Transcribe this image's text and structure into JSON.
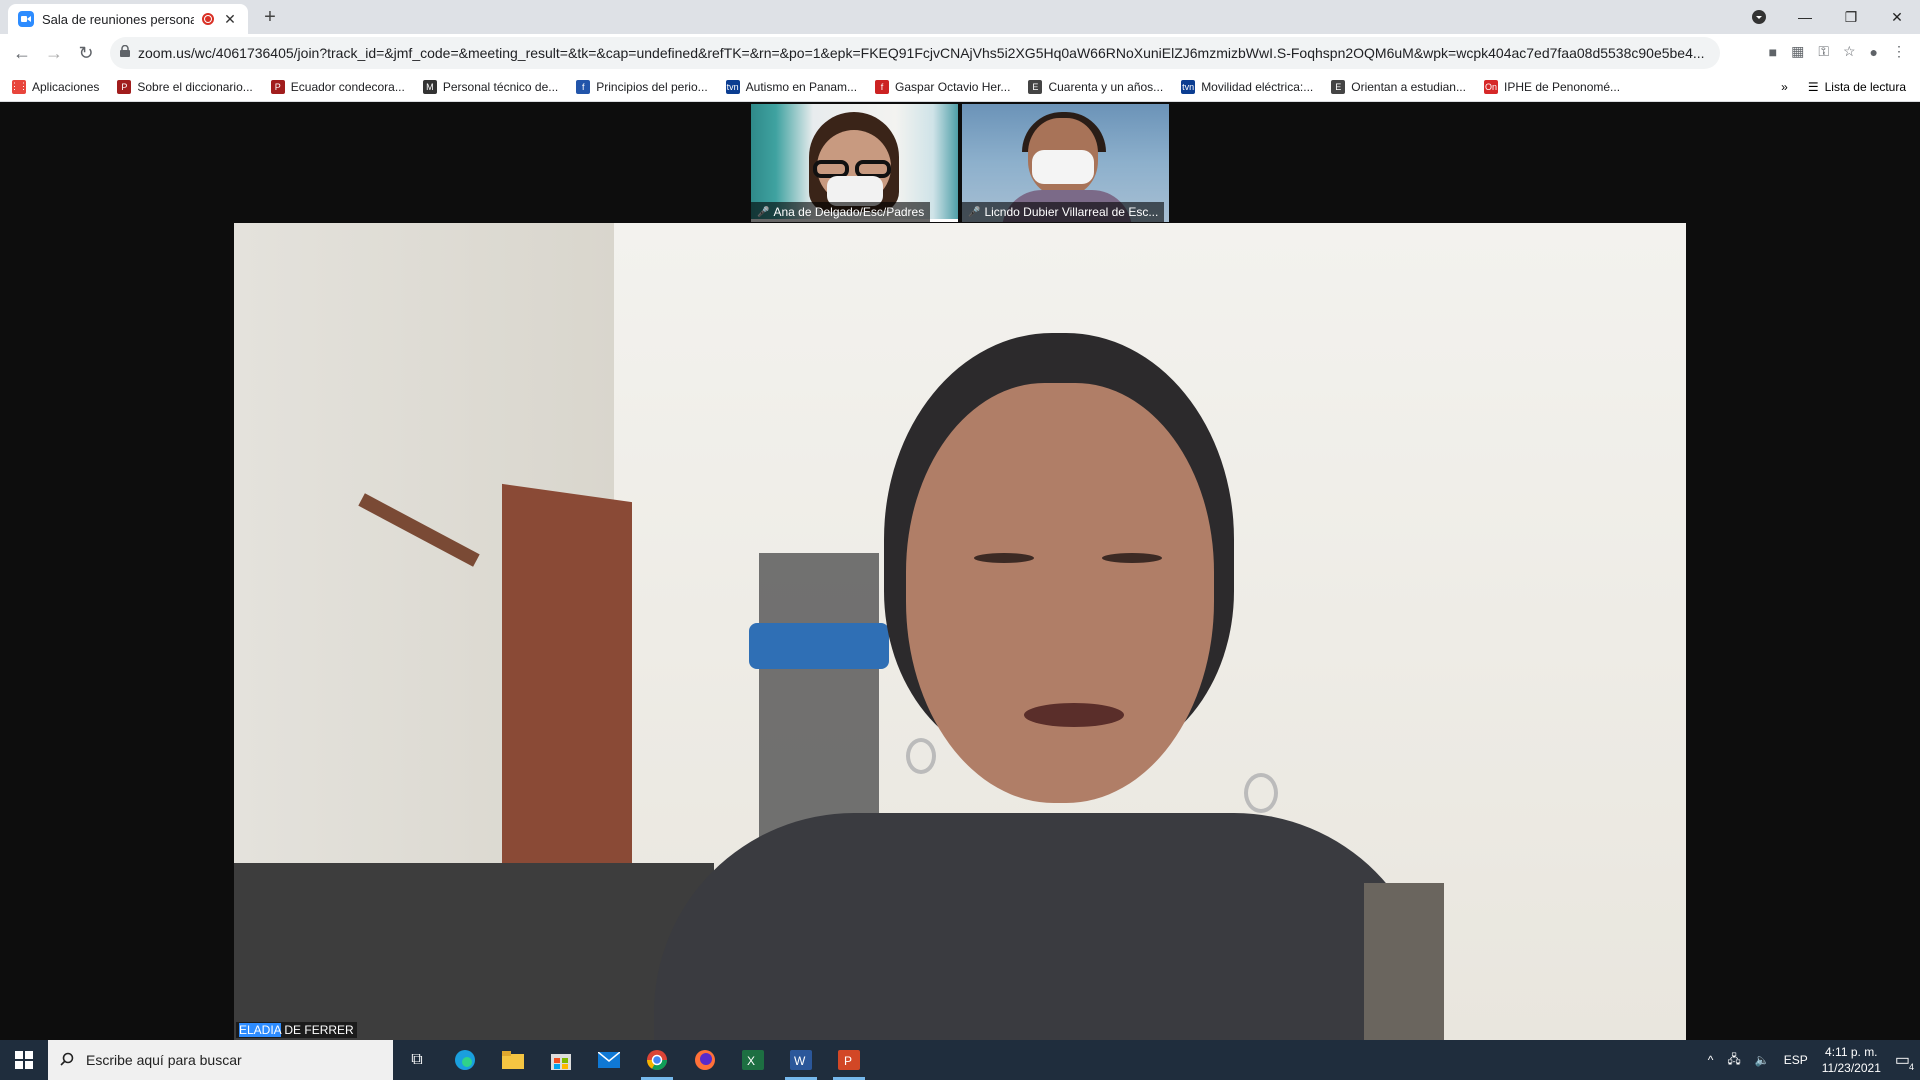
{
  "browser": {
    "tab_title": "Sala de reuniones personales",
    "url": "zoom.us/wc/4061736405/join?track_id=&jmf_code=&meeting_result=&tk=&cap=undefined&refTK=&rn=&po=1&epk=FKEQ91FcjvCNAjVhs5i2XG5Hq0aW66RNoXuniElZJ6mzmizbWwI.S-Foqhspn2OQM6uM&wpk=wcpk404ac7ed7faa08d5538c90e5be4..."
  },
  "bookmarks": [
    {
      "label": "Aplicaciones",
      "icon": "apps-grid-icon",
      "color": "#e8453c"
    },
    {
      "label": "Sobre el diccionario...",
      "icon": "P",
      "color": "#a11d1d"
    },
    {
      "label": "Ecuador condecora...",
      "icon": "P",
      "color": "#a11d1d"
    },
    {
      "label": "Personal técnico de...",
      "icon": "M",
      "color": "#333333"
    },
    {
      "label": "Principios del perio...",
      "icon": "f",
      "color": "#2255aa"
    },
    {
      "label": "Autismo en Panam...",
      "icon": "tvn",
      "color": "#0b3d91"
    },
    {
      "label": "Gaspar Octavio Her...",
      "icon": "f",
      "color": "#cc2222"
    },
    {
      "label": "Cuarenta y un años...",
      "icon": "E",
      "color": "#444444"
    },
    {
      "label": "Movilidad eléctrica:...",
      "icon": "tvn",
      "color": "#0b3d91"
    },
    {
      "label": "Orientan a estudian...",
      "icon": "E",
      "color": "#444444"
    },
    {
      "label": "IPHE de Penonomé...",
      "icon": "On",
      "color": "#d62828"
    }
  ],
  "reading_list": "Lista de lectura",
  "participants": [
    {
      "name": "Ana de Delgado/Esc/Padres",
      "mic": "muted"
    },
    {
      "name": "Licndo Dubier Villarreal de Esc...",
      "mic": "muted"
    }
  ],
  "main_speaker": {
    "first": "ELADIA",
    "rest": " DE FERRER"
  },
  "taskbar": {
    "search_placeholder": "Escribe aquí para buscar",
    "language": "ESP",
    "time": "4:11 p. m.",
    "date": "11/23/2021",
    "notifications": "4"
  }
}
